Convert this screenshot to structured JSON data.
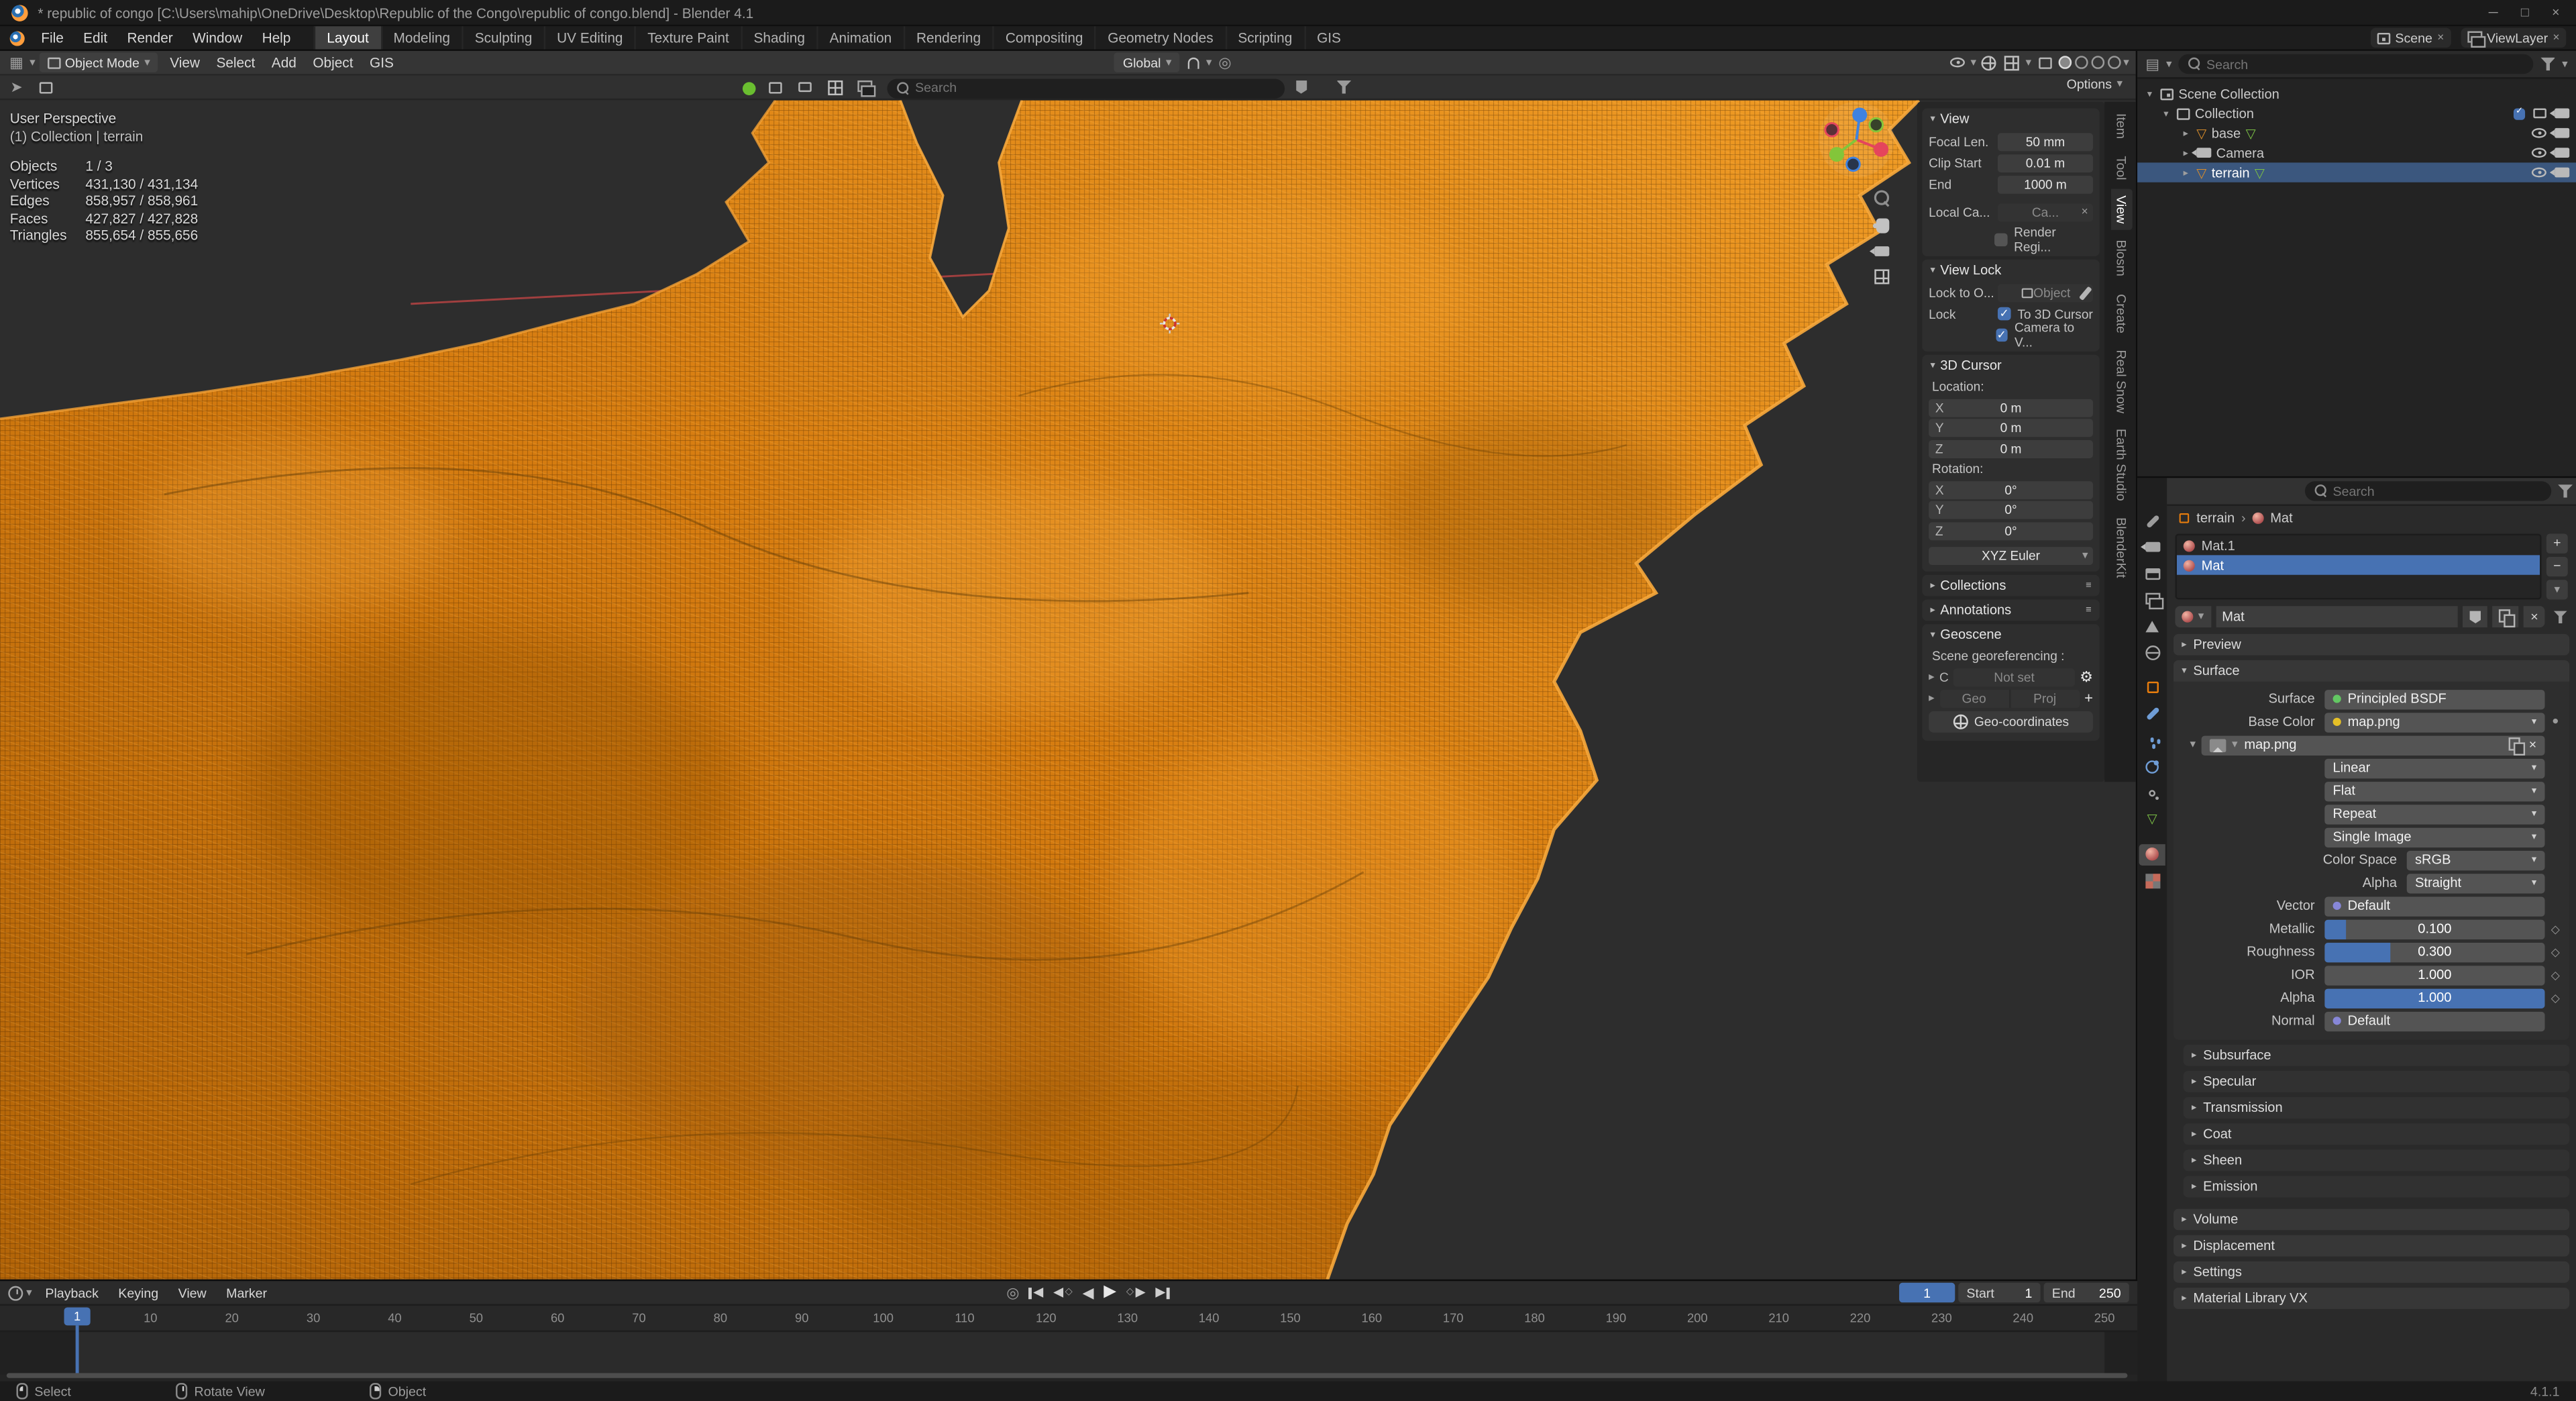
{
  "colors": {
    "accent": "#4772b3",
    "object_orange": "#e87d0d",
    "terrain_orange": "#d8780f",
    "selected_row": "#3b577e"
  },
  "icons": {
    "chevron-down": "▾",
    "chevron-right": "▸",
    "close": "×",
    "plus": "+",
    "minus": "−",
    "check": "✓",
    "diamond": "◇",
    "dot": "●",
    "menu": "≡",
    "gear": "⚙",
    "play": "▶",
    "reverse": "◀",
    "record": "◎",
    "mesh": "▽",
    "proportional": "◎",
    "breadcrumb-sep": "›",
    "viewport-editor": "▦",
    "outliner-editor": "▤",
    "properties-editor": "▥",
    "search-icon": "css-magnifier",
    "magnet-icon": "css-shape",
    "camera-icon": "css-shape",
    "eye-icon": "css-shape",
    "hand-icon": "css-shape",
    "zoom-icon": "css-magnifier",
    "grid-icon": "css-shape",
    "globe-icon": "css-shape",
    "funnel-icon": "css-shape",
    "shield-icon": "css-shape",
    "image-icon": "css-shape",
    "mouse-icon": "css-shape",
    "clock-icon": "css-shape",
    "eyedropper-icon": "css-shape"
  },
  "titlebar": {
    "title": "* republic of congo [C:\\Users\\mahip\\OneDrive\\Desktop\\Republic of the Congo\\republic of congo.blend] - Blender 4.1"
  },
  "topbar": {
    "menus": [
      "File",
      "Edit",
      "Render",
      "Window",
      "Help"
    ],
    "workspaces": [
      "Layout",
      "Modeling",
      "Sculpting",
      "UV Editing",
      "Texture Paint",
      "Shading",
      "Animation",
      "Rendering",
      "Compositing",
      "Geometry Nodes",
      "Scripting",
      "GIS"
    ],
    "active_workspace": "Layout",
    "scene": "Scene",
    "viewlayer": "ViewLayer"
  },
  "viewport": {
    "header": {
      "mode": "Object Mode",
      "menus": [
        "View",
        "Select",
        "Add",
        "Object",
        "GIS"
      ],
      "orientation": "Global",
      "options": "Options"
    },
    "toolbar": {
      "search_placeholder": "Search"
    },
    "overlay": {
      "perspective": "User Perspective",
      "collection": "(1) Collection | terrain",
      "stats": [
        {
          "label": "Objects",
          "value": "1 / 3"
        },
        {
          "label": "Vertices",
          "value": "431,130 / 431,134"
        },
        {
          "label": "Edges",
          "value": "858,957 / 858,961"
        },
        {
          "label": "Faces",
          "value": "427,827 / 427,828"
        },
        {
          "label": "Triangles",
          "value": "855,654 / 855,656"
        }
      ]
    }
  },
  "npanel": {
    "tabs": [
      "Item",
      "Tool",
      "View",
      "Blosm",
      "Create",
      "Real Snow",
      "Earth Studio",
      "BlenderKit"
    ],
    "active_tab": "View",
    "view": {
      "title": "View",
      "focal_label": "Focal Len.",
      "focal_value": "50 mm",
      "clip_label": "Clip Start",
      "clip_value": "0.01 m",
      "end_label": "End",
      "end_value": "1000 m",
      "local_label": "Local Ca...",
      "local_value": "Ca...",
      "render_region_label": "Render Regi..."
    },
    "view_lock": {
      "title": "View Lock",
      "lock_to_label": "Lock to O...",
      "lock_to_value": "Object",
      "lock_label": "Lock",
      "cursor_label": "To 3D Cursor",
      "camera_label": "Camera to V..."
    },
    "cursor": {
      "title": "3D Cursor",
      "location_label": "Location:",
      "rotation_label": "Rotation:",
      "loc": [
        {
          "axis": "X",
          "value": "0 m"
        },
        {
          "axis": "Y",
          "value": "0 m"
        },
        {
          "axis": "Z",
          "value": "0 m"
        }
      ],
      "rot": [
        {
          "axis": "X",
          "value": "0°"
        },
        {
          "axis": "Y",
          "value": "0°"
        },
        {
          "axis": "Z",
          "value": "0°"
        }
      ],
      "euler": "XYZ Euler"
    },
    "collections_title": "Collections",
    "annotations_title": "Annotations",
    "geoscene": {
      "title": "Geoscene",
      "georef_label": "Scene georeferencing :",
      "crs_prefix": "C",
      "crs_value": "Not set",
      "geo_button": "Geo",
      "proj_button": "Proj",
      "coords_button": "Geo-coordinates"
    }
  },
  "outliner": {
    "search_placeholder": "Search",
    "rows": [
      {
        "label": "Scene Collection"
      },
      {
        "label": "Collection"
      },
      {
        "label": "base"
      },
      {
        "label": "Camera"
      },
      {
        "label": "terrain"
      }
    ]
  },
  "properties": {
    "search_placeholder": "Search",
    "breadcrumb": {
      "object": "terrain",
      "material": "Mat"
    },
    "slots": [
      "Mat.1",
      "Mat"
    ],
    "active_slot": "Mat",
    "datablock": "Mat",
    "preview_title": "Preview",
    "surface": {
      "title": "Surface",
      "surface_label": "Surface",
      "surface_value": "Principled BSDF",
      "base_color_label": "Base Color",
      "base_color_value": "map.png",
      "image_name": "map.png",
      "interpolation": "Linear",
      "projection": "Flat",
      "extension": "Repeat",
      "source": "Single Image",
      "colorspace_label": "Color Space",
      "colorspace_value": "sRGB",
      "alpha_mode_label": "Alpha",
      "alpha_mode_value": "Straight",
      "vector_label": "Vector",
      "vector_value": "Default",
      "metallic_label": "Metallic",
      "metallic_value": "0.100",
      "metallic_pct": 10,
      "roughness_label": "Roughness",
      "roughness_value": "0.300",
      "roughness_pct": 30,
      "ior_label": "IOR",
      "ior_value": "1.000",
      "alpha_label": "Alpha",
      "alpha_value": "1.000",
      "alpha_pct": 100,
      "normal_label": "Normal",
      "normal_value": "Default",
      "subpanels": [
        "Subsurface",
        "Specular",
        "Transmission",
        "Coat",
        "Sheen",
        "Emission"
      ]
    },
    "bottom_panels": [
      "Volume",
      "Displacement",
      "Settings",
      "Material Library VX"
    ]
  },
  "timeline": {
    "menus": [
      "Playback",
      "Keying",
      "View",
      "Marker"
    ],
    "current_frame": "1",
    "start_label": "Start",
    "start_value": "1",
    "end_label": "End",
    "end_value": "250",
    "frames": [
      1,
      10,
      20,
      30,
      40,
      50,
      60,
      70,
      80,
      90,
      100,
      110,
      120,
      130,
      140,
      150,
      160,
      170,
      180,
      190,
      200,
      210,
      220,
      230,
      240,
      250
    ],
    "frame_min": 1,
    "frame_max": 250
  },
  "statusbar": {
    "hints": [
      "Select",
      "Rotate View",
      "Object"
    ],
    "version": "4.1.1"
  }
}
